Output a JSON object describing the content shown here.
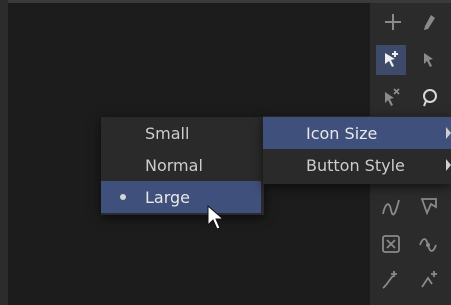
{
  "context_menu": {
    "items": [
      {
        "label": "Icon Size",
        "has_submenu": true,
        "highlighted": true
      },
      {
        "label": "Button Style",
        "has_submenu": true,
        "highlighted": false
      }
    ]
  },
  "icon_size_submenu": {
    "items": [
      {
        "label": "Small",
        "selected": false,
        "highlighted": false
      },
      {
        "label": "Normal",
        "selected": false,
        "highlighted": false
      },
      {
        "label": "Large",
        "selected": true,
        "highlighted": true
      }
    ]
  },
  "toolbar": {
    "icons": [
      "add-point-icon",
      "pen-icon",
      "select-add-icon",
      "select-icon",
      "select-remove-icon",
      "lasso-icon",
      "curve-smooth-icon",
      "curve-corner-icon",
      "delete-point-icon",
      "curve-loop-icon",
      "move-point-icon",
      "transform-point-icon"
    ],
    "active_icon": "select-add-icon"
  },
  "colors": {
    "background": "#1f1f1f",
    "menu": "#2a2a2a",
    "highlight": "#40507d",
    "toolbar": "#2b2b2b"
  }
}
